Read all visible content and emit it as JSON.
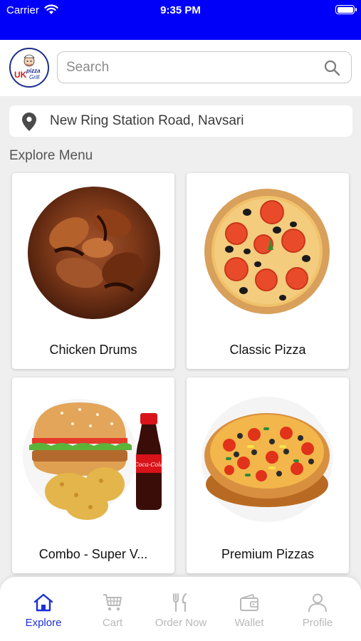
{
  "status_bar": {
    "carrier": "Carrier",
    "time": "9:35 PM"
  },
  "header": {
    "logo_text": {
      "line1": "UK",
      "line2": "pizza",
      "line3": "Grill"
    },
    "search": {
      "placeholder": "Search",
      "value": ""
    }
  },
  "location": {
    "address": "New Ring Station Road, Navsari"
  },
  "explore": {
    "title": "Explore Menu",
    "items": [
      {
        "label": "Chicken Drums"
      },
      {
        "label": "Classic Pizza"
      },
      {
        "label": "Combo - Super V..."
      },
      {
        "label": "Premium Pizzas"
      }
    ]
  },
  "tabbar": {
    "tabs": [
      {
        "label": "Explore",
        "icon": "home-icon",
        "active": true
      },
      {
        "label": "Cart",
        "icon": "cart-icon",
        "active": false
      },
      {
        "label": "Order Now",
        "icon": "fork-knife-icon",
        "active": false
      },
      {
        "label": "Wallet",
        "icon": "wallet-icon",
        "active": false
      },
      {
        "label": "Profile",
        "icon": "person-icon",
        "active": false
      }
    ]
  },
  "colors": {
    "status_bar": "#0000fa",
    "active_tab": "#1a2fd6",
    "inactive_tab": "#b9b9b9"
  }
}
